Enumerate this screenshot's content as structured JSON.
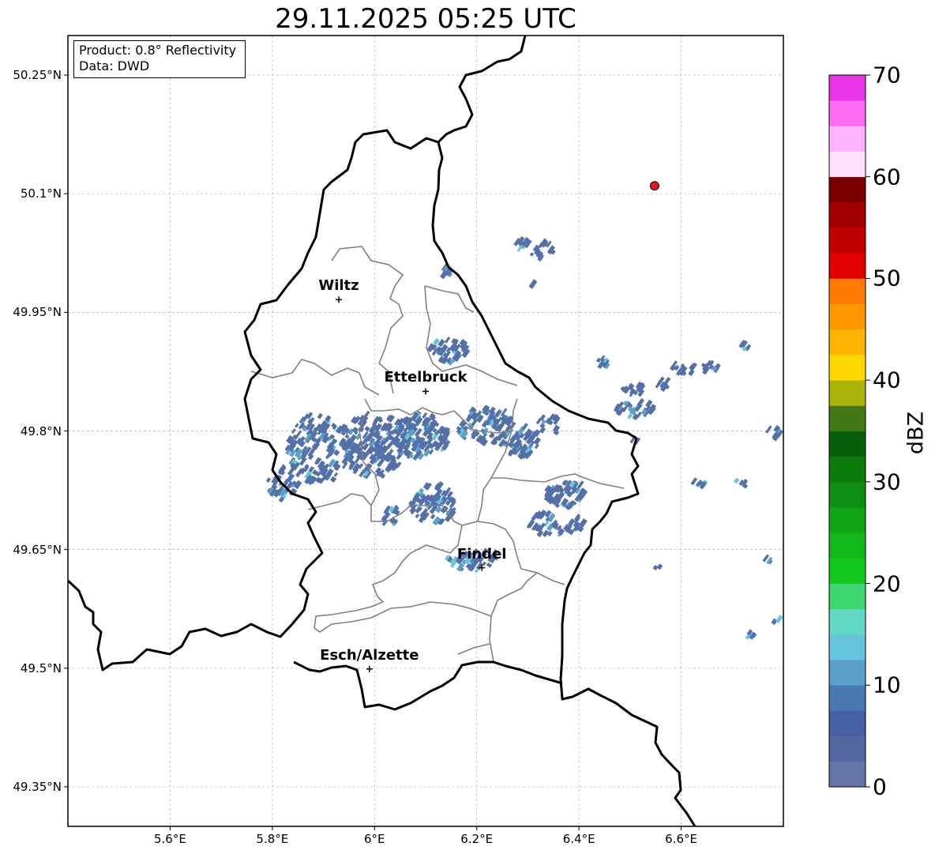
{
  "title": "29.11.2025 05:25 UTC",
  "info_box": {
    "line1": "Product: 0.8° Reflectivity",
    "line2": "Data: DWD"
  },
  "map": {
    "lon_range": [
      5.4,
      6.8
    ],
    "lat_range": [
      49.3,
      50.3
    ],
    "lat_ticks": [
      {
        "value": 50.25,
        "label": "50.25°N"
      },
      {
        "value": 50.1,
        "label": "50.1°N"
      },
      {
        "value": 49.95,
        "label": "49.95°N"
      },
      {
        "value": 49.8,
        "label": "49.8°N"
      },
      {
        "value": 49.65,
        "label": "49.65°N"
      },
      {
        "value": 49.5,
        "label": "49.5°N"
      },
      {
        "value": 49.35,
        "label": "49.35°N"
      }
    ],
    "lon_ticks": [
      {
        "value": 5.6,
        "label": "5.6°E"
      },
      {
        "value": 5.8,
        "label": "5.8°E"
      },
      {
        "value": 6.0,
        "label": "6°E"
      },
      {
        "value": 6.2,
        "label": "6.2°E"
      },
      {
        "value": 6.4,
        "label": "6.4°E"
      },
      {
        "value": 6.6,
        "label": "6.6°E"
      }
    ],
    "grid": true,
    "cities": [
      {
        "name": "Wiltz",
        "lon": 5.93,
        "lat": 49.966
      },
      {
        "name": "Ettelbruck",
        "lon": 6.1,
        "lat": 49.85
      },
      {
        "name": "Findel",
        "lon": 6.21,
        "lat": 49.627
      },
      {
        "name": "Esch/Alzette",
        "lon": 5.99,
        "lat": 49.499
      }
    ],
    "radar_site": {
      "lon": 6.548,
      "lat": 50.11,
      "color": "#e8141c"
    },
    "colors": {
      "country_border": "#000000",
      "canton_border": "#808080",
      "grid": "#b0b0b0",
      "echo_main": "#5470a8",
      "echo_light": "#5aa2c8",
      "echo_cyan": "#66c6de"
    }
  },
  "colorbar": {
    "label": "dBZ",
    "min": 0,
    "max": 70,
    "ticks": [
      0,
      10,
      20,
      30,
      40,
      50,
      60,
      70
    ],
    "colors": [
      "#6475a8",
      "#5266a0",
      "#4660a2",
      "#4a78b0",
      "#5aa0c8",
      "#66c4dc",
      "#60d8c4",
      "#3ed670",
      "#12c81e",
      "#10b81a",
      "#10a414",
      "#0e8e10",
      "#0a7a0c",
      "#06600a",
      "#447816",
      "#aab408",
      "#ffd800",
      "#ffb400",
      "#ff9800",
      "#ff7c00",
      "#e40000",
      "#c00000",
      "#a00000",
      "#7a0000",
      "#ffe0fc",
      "#ffb4ff",
      "#ff6cf4",
      "#ea34ea"
    ]
  }
}
